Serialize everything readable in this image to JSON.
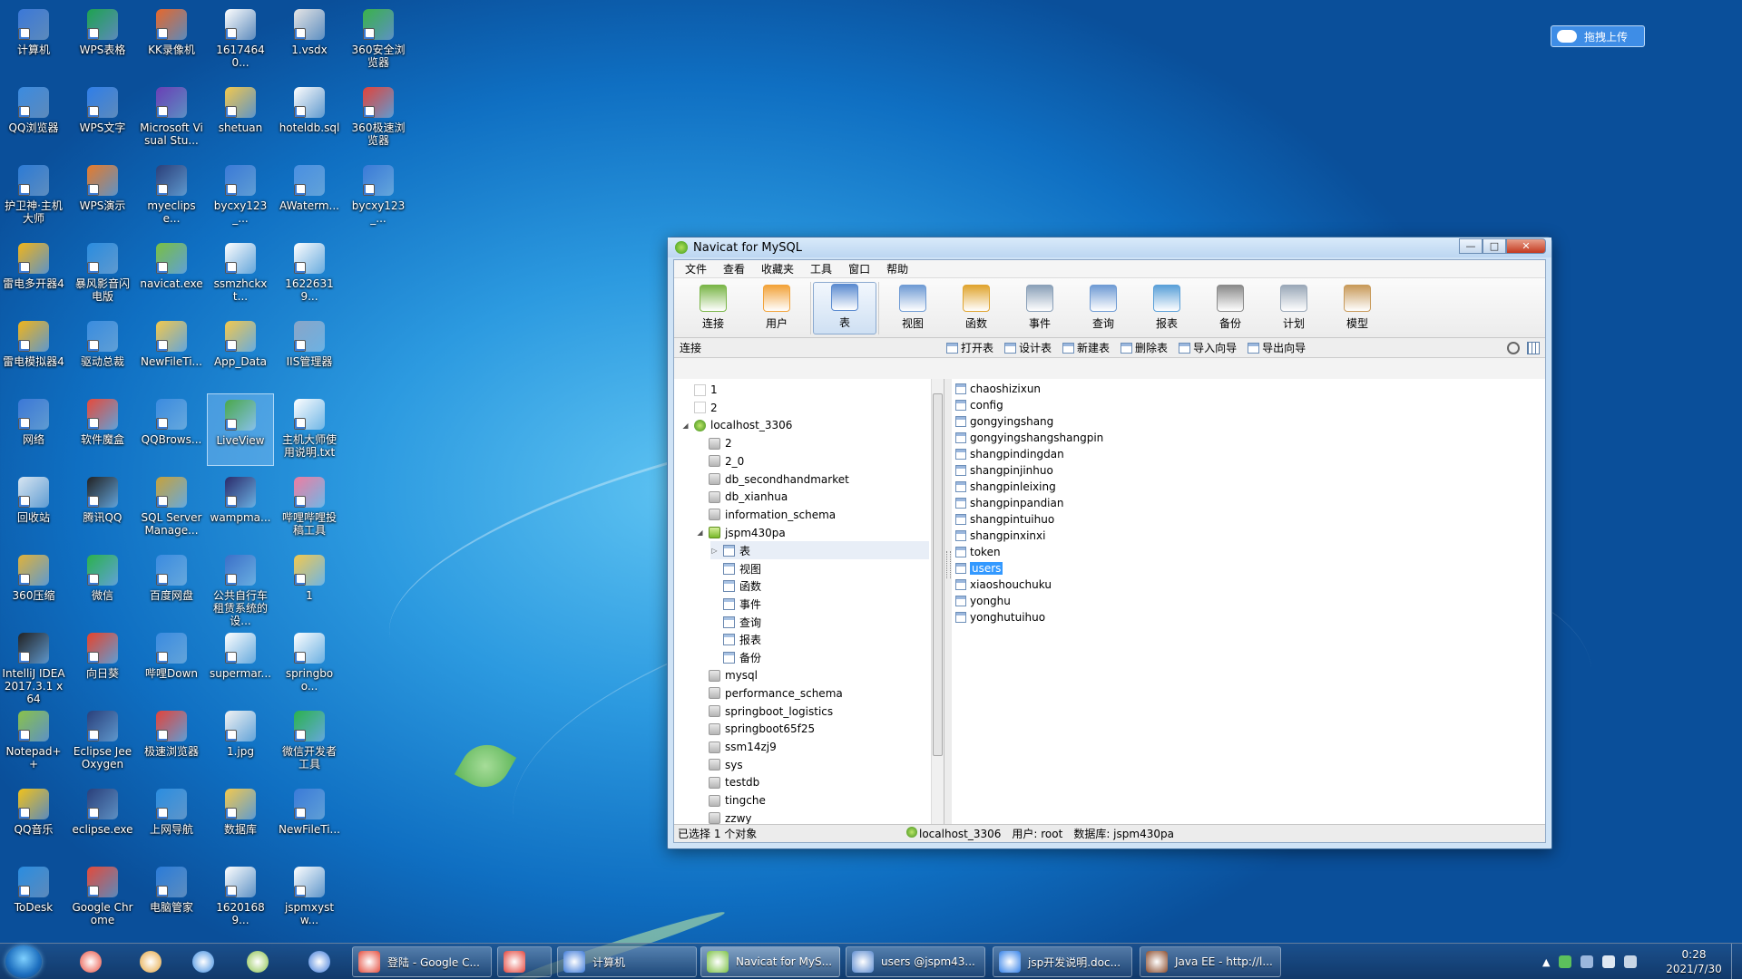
{
  "desktop": {
    "icons": [
      {
        "label": "计算机",
        "color": "#3b78d8"
      },
      {
        "label": "WPS表格",
        "color": "#1ea34f"
      },
      {
        "label": "KK录像机",
        "color": "#e8672a"
      },
      {
        "label": "16174640...",
        "color": "#ffffff"
      },
      {
        "label": "1.vsdx",
        "color": "#e6e6e6"
      },
      {
        "label": "360安全浏览器",
        "color": "#3ab34a"
      },
      {
        "label": "QQ浏览器",
        "color": "#3b8be0"
      },
      {
        "label": "WPS文字",
        "color": "#2f7ee8"
      },
      {
        "label": "Microsoft Visual Stu...",
        "color": "#6a3fb6"
      },
      {
        "label": "shetuan",
        "color": "#f3c94e"
      },
      {
        "label": "hoteldb.sql",
        "color": "#ffffff"
      },
      {
        "label": "360极速浏览器",
        "color": "#e4433a"
      },
      {
        "label": "护卫神·主机大师",
        "color": "#2c7bd6"
      },
      {
        "label": "WPS演示",
        "color": "#e87b2a"
      },
      {
        "label": "myeclipse...",
        "color": "#2a3f7a"
      },
      {
        "label": "bycxy123_...",
        "color": "#3a7ad8"
      },
      {
        "label": "AWaterm...",
        "color": "#4a90e2"
      },
      {
        "label": "bycxy123_...",
        "color": "#3a7ad8"
      },
      {
        "label": "雷电多开器4",
        "color": "#f2b51a"
      },
      {
        "label": "暴风影音闪电版",
        "color": "#2a8de0"
      },
      {
        "label": "navicat.exe",
        "color": "#7ac142"
      },
      {
        "label": "ssmzhckxt...",
        "color": "#ffffff"
      },
      {
        "label": "16226319...",
        "color": "#ffffff"
      },
      {
        "label": "雷电模拟器4",
        "color": "#f2b51a"
      },
      {
        "label": "驱动总裁",
        "color": "#3a8de0"
      },
      {
        "label": "NewFileTi...",
        "color": "#f3c94e"
      },
      {
        "label": "App_Data",
        "color": "#f3c94e"
      },
      {
        "label": "IIS管理器",
        "color": "#8aa6c8"
      },
      {
        "label": "网络",
        "color": "#3b78d8"
      },
      {
        "label": "软件魔盒",
        "color": "#e84a3a"
      },
      {
        "label": "QQBrows...",
        "color": "#3b8be0"
      },
      {
        "label": "LiveView",
        "color": "#4aa84a"
      },
      {
        "label": "主机大师使用说明.txt",
        "color": "#ffffff"
      },
      {
        "label": "回收站",
        "color": "#d8e6f2"
      },
      {
        "label": "腾讯QQ",
        "color": "#222222"
      },
      {
        "label": "SQL Server Manage...",
        "color": "#c8a23a"
      },
      {
        "label": "wampma...",
        "color": "#2a2a6a"
      },
      {
        "label": "哔哩哔哩投稿工具",
        "color": "#f07ca0"
      },
      {
        "label": "360压缩",
        "color": "#e0b23a"
      },
      {
        "label": "微信",
        "color": "#2bb24c"
      },
      {
        "label": "百度网盘",
        "color": "#3b8be0"
      },
      {
        "label": "公共自行车租赁系统的设...",
        "color": "#3b6fc8"
      },
      {
        "label": "1",
        "color": "#f3c94e"
      },
      {
        "label": "IntelliJ IDEA 2017.3.1 x64",
        "color": "#222222"
      },
      {
        "label": "向日葵",
        "color": "#e8432a"
      },
      {
        "label": "哔哩Down",
        "color": "#3b8be0"
      },
      {
        "label": "supermar...",
        "color": "#ffffff"
      },
      {
        "label": "springboo...",
        "color": "#ffffff"
      },
      {
        "label": "Notepad++",
        "color": "#8ac24a"
      },
      {
        "label": "Eclipse Jee Oxygen",
        "color": "#2a3f7a"
      },
      {
        "label": "极速浏览器",
        "color": "#e4433a"
      },
      {
        "label": "1.jpg",
        "color": "#f2f2f2"
      },
      {
        "label": "微信开发者工具",
        "color": "#2bb24c"
      },
      {
        "label": "QQ音乐",
        "color": "#f2c21a"
      },
      {
        "label": "eclipse.exe",
        "color": "#2a3f7a"
      },
      {
        "label": "上网导航",
        "color": "#2a8de0"
      },
      {
        "label": "数据库",
        "color": "#f3c94e"
      },
      {
        "label": "NewFileTi...",
        "color": "#3a7ad8"
      },
      {
        "label": "ToDesk",
        "color": "#2a8de0"
      },
      {
        "label": "Google Chrome",
        "color": "#e44a3a"
      },
      {
        "label": "电脑管家",
        "color": "#2a7bd8"
      },
      {
        "label": "16201689...",
        "color": "#ffffff"
      },
      {
        "label": "jspmxystw...",
        "color": "#ffffff"
      }
    ],
    "upload_button": "拖拽上传"
  },
  "window": {
    "title": "Navicat for MySQL",
    "min": "—",
    "max": "□",
    "close": "✕",
    "menu": [
      "文件",
      "查看",
      "收藏夹",
      "工具",
      "窗口",
      "帮助"
    ],
    "toolbar": [
      {
        "label": "连接",
        "color": "#7ab648"
      },
      {
        "label": "用户",
        "color": "#f2a33a"
      },
      {
        "label": "表",
        "color": "#5b8bd0"
      },
      {
        "label": "视图",
        "color": "#6f9bd4"
      },
      {
        "label": "函数",
        "color": "#e0a530"
      },
      {
        "label": "事件",
        "color": "#8aa0b8"
      },
      {
        "label": "查询",
        "color": "#6f9bd4"
      },
      {
        "label": "报表",
        "color": "#5aa0d8"
      },
      {
        "label": "备份",
        "color": "#8a8a8a"
      },
      {
        "label": "计划",
        "color": "#9aa8b8"
      },
      {
        "label": "模型",
        "color": "#c89a5a"
      }
    ],
    "active_tool": "表",
    "connections_label": "连接",
    "object_actions": [
      "打开表",
      "设计表",
      "新建表",
      "删除表",
      "导入向导",
      "导出向导"
    ],
    "tree": [
      {
        "label": "1",
        "level": 0,
        "icon": "blank",
        "toggle": ""
      },
      {
        "label": "2",
        "level": 0,
        "icon": "blank",
        "toggle": ""
      },
      {
        "label": "localhost_3306",
        "level": 0,
        "icon": "conn",
        "toggle": "◢"
      },
      {
        "label": "2",
        "level": 1,
        "icon": "db",
        "toggle": ""
      },
      {
        "label": "2_0",
        "level": 1,
        "icon": "db",
        "toggle": ""
      },
      {
        "label": "db_secondhandmarket",
        "level": 1,
        "icon": "db",
        "toggle": ""
      },
      {
        "label": "db_xianhua",
        "level": 1,
        "icon": "db",
        "toggle": ""
      },
      {
        "label": "information_schema",
        "level": 1,
        "icon": "db",
        "toggle": ""
      },
      {
        "label": "jspm430pa",
        "level": 1,
        "icon": "dbopen",
        "toggle": "◢"
      },
      {
        "label": "表",
        "level": 2,
        "icon": "cat",
        "toggle": "▷",
        "selected": true
      },
      {
        "label": "视图",
        "level": 2,
        "icon": "cat",
        "toggle": ""
      },
      {
        "label": "函数",
        "level": 2,
        "icon": "cat",
        "toggle": ""
      },
      {
        "label": "事件",
        "level": 2,
        "icon": "cat",
        "toggle": ""
      },
      {
        "label": "查询",
        "level": 2,
        "icon": "cat",
        "toggle": ""
      },
      {
        "label": "报表",
        "level": 2,
        "icon": "cat",
        "toggle": ""
      },
      {
        "label": "备份",
        "level": 2,
        "icon": "cat",
        "toggle": ""
      },
      {
        "label": "mysql",
        "level": 1,
        "icon": "db",
        "toggle": ""
      },
      {
        "label": "performance_schema",
        "level": 1,
        "icon": "db",
        "toggle": ""
      },
      {
        "label": "springboot_logistics",
        "level": 1,
        "icon": "db",
        "toggle": ""
      },
      {
        "label": "springboot65f25",
        "level": 1,
        "icon": "db",
        "toggle": ""
      },
      {
        "label": "ssm14zj9",
        "level": 1,
        "icon": "db",
        "toggle": ""
      },
      {
        "label": "sys",
        "level": 1,
        "icon": "db",
        "toggle": ""
      },
      {
        "label": "testdb",
        "level": 1,
        "icon": "db",
        "toggle": ""
      },
      {
        "label": "tingche",
        "level": 1,
        "icon": "db",
        "toggle": ""
      },
      {
        "label": "zzwy",
        "level": 1,
        "icon": "db",
        "toggle": ""
      }
    ],
    "tables": [
      "chaoshizixun",
      "config",
      "gongyingshang",
      "gongyingshangshangpin",
      "shangpindingdan",
      "shangpinjinhuo",
      "shangpinleixing",
      "shangpinpandian",
      "shangpintuihuo",
      "shangpinxinxi",
      "token",
      "users",
      "xiaoshouchuku",
      "yonghu",
      "yonghutuihuo"
    ],
    "selected_table": "users",
    "status": {
      "selection": "已选择 1 个对象",
      "connection": "localhost_3306",
      "user": "用户: root",
      "database": "数据库: jspm430pa"
    }
  },
  "taskbar": {
    "pinned": [
      {
        "name": "tencent-pc-manager-icon",
        "color": "#e84a3a"
      },
      {
        "name": "chrome-icon",
        "color": "#e4a33a"
      },
      {
        "name": "baidu-netdisk-icon",
        "color": "#3b8be0"
      },
      {
        "name": "notepad-plus-icon",
        "color": "#8ac24a"
      },
      {
        "name": "control-panel-icon",
        "color": "#3b78d8"
      }
    ],
    "tasks": [
      {
        "label": "登陆 - Google C...",
        "color": "#e44a3a",
        "active": false
      },
      {
        "label": "",
        "color": "#e4433a",
        "active": false
      },
      {
        "label": "计算机",
        "color": "#3b78d8",
        "active": false
      },
      {
        "label": "Navicat for MyS...",
        "color": "#7ac142",
        "active": true
      },
      {
        "label": "users @jspm43...",
        "color": "#5b8bd0",
        "active": false
      },
      {
        "label": "jsp开发说明.doc...",
        "color": "#2f7ee8",
        "active": false
      },
      {
        "label": "Java EE - http://l...",
        "color": "#8a4a2a",
        "active": false
      }
    ],
    "clock_time": "0:28",
    "clock_date": "2021/7/30",
    "tray_arrow": "▲"
  }
}
